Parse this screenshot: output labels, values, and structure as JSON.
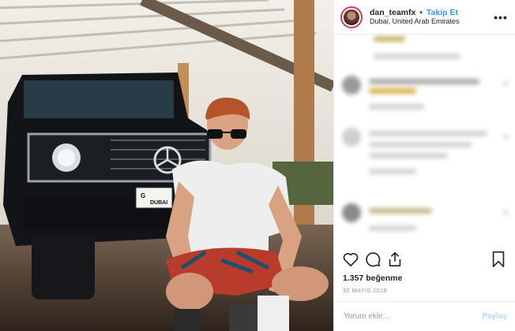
{
  "header": {
    "username": "dan_teamfx",
    "separator": "•",
    "follow_label": "Takip Et",
    "location": "Dubai, United Arab Emirates"
  },
  "photo": {
    "plate_letter": "G",
    "plate_city": "DUBAI"
  },
  "actions": {
    "like_icon": "heart-icon",
    "comment_icon": "comment-icon",
    "share_icon": "share-icon",
    "save_icon": "bookmark-icon"
  },
  "likes": "1.357 beğenme",
  "date": "30 MAYIS 2018",
  "comment_box": {
    "placeholder": "Yorum ekle...",
    "post_label": "Paylaş"
  },
  "colors": {
    "follow": "#3897f0",
    "post_disabled": "#b3d7fb",
    "avatar_ring": "#e1306c"
  }
}
